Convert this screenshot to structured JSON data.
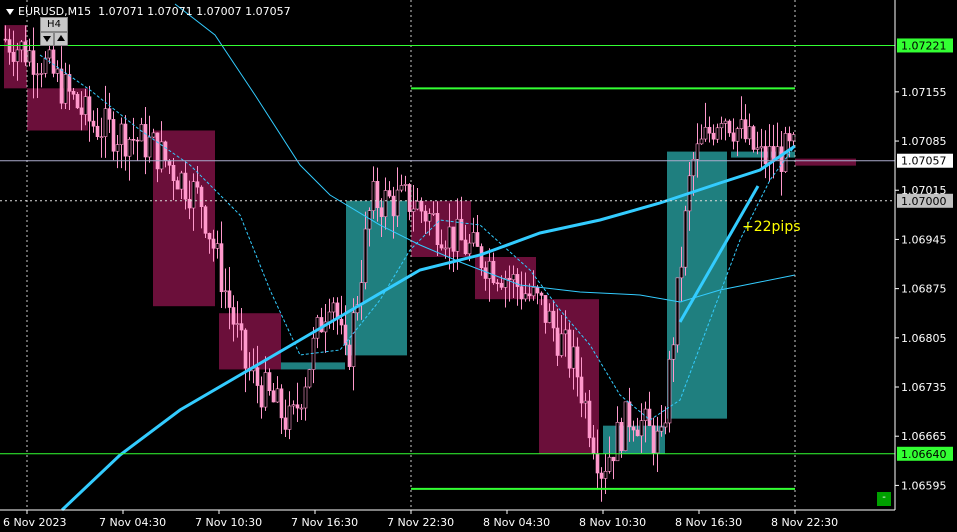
{
  "header": {
    "symbol_timeframe": "EURUSD,M15",
    "ohlc": "1.07071 1.07071 1.07007 1.07057"
  },
  "timeframe_box": {
    "label": "H4"
  },
  "annotation": {
    "text": "+22pips"
  },
  "price_axis": {
    "labels": [
      "1.07155",
      "1.07085",
      "1.07015",
      "1.06945",
      "1.06875",
      "1.06805",
      "1.06735",
      "1.06665",
      "1.06595"
    ],
    "tags": {
      "upper_level": "1.07221",
      "current_price": "1.07057",
      "crosshair_price": "1.07000",
      "lower_level": "1.06640"
    }
  },
  "time_axis": {
    "labels": [
      "6 Nov 2023",
      "7 Nov 04:30",
      "7 Nov 10:30",
      "7 Nov 16:30",
      "7 Nov 22:30",
      "8 Nov 04:30",
      "8 Nov 10:30",
      "8 Nov 16:30",
      "8 Nov 22:30"
    ]
  },
  "colors": {
    "bull_candle": "#ff99cc",
    "bear_candle": "#ff99cc",
    "h4_bear_box": "#6b0f3a",
    "h4_bull_box": "#1f7f7f",
    "ma_fast": "#33ccff",
    "ma_slow": "#33ccff",
    "level_lines": "#33ff33",
    "tag_green": "#33ff33",
    "tag_gray": "#c0c0c0",
    "pips_text": "#ffff00"
  },
  "chart_data": {
    "type": "candlestick",
    "symbol": "EURUSD",
    "timeframe": "M15",
    "y_range": [
      1.0656,
      1.0728
    ],
    "x_labels": [
      "6 Nov 2023",
      "7 Nov 04:30",
      "7 Nov 10:30",
      "7 Nov 16:30",
      "7 Nov 22:30",
      "8 Nov 04:30",
      "8 Nov 10:30",
      "8 Nov 16:30",
      "8 Nov 22:30"
    ],
    "horizontal_levels": [
      1.07221,
      1.07057,
      1.07,
      1.0664
    ],
    "session_range_lines": [
      1.0716,
      1.0659
    ],
    "h4_boxes": [
      {
        "start_label": "6 Nov 2023",
        "open": 1.0725,
        "close": 1.0716,
        "dir": "bear"
      },
      {
        "start_label": "6 Nov 2023",
        "open": 1.0716,
        "close": 1.071,
        "dir": "bear"
      },
      {
        "start_label": "7 Nov 04:30",
        "open": 1.071,
        "close": 1.0685,
        "dir": "bear"
      },
      {
        "start_label": "7 Nov 10:30",
        "open": 1.0684,
        "close": 1.0676,
        "dir": "bear"
      },
      {
        "start_label": "7 Nov 10:30",
        "open": 1.0676,
        "close": 1.0677,
        "dir": "bull"
      },
      {
        "start_label": "7 Nov 16:30",
        "open": 1.0678,
        "close": 1.07,
        "dir": "bull"
      },
      {
        "start_label": "7 Nov 22:30",
        "open": 1.07,
        "close": 1.0692,
        "dir": "bear"
      },
      {
        "start_label": "8 Nov 04:30",
        "open": 1.0692,
        "close": 1.0686,
        "dir": "bear"
      },
      {
        "start_label": "8 Nov 04:30",
        "open": 1.0686,
        "close": 1.0664,
        "dir": "bear"
      },
      {
        "start_label": "8 Nov 10:30",
        "open": 1.0664,
        "close": 1.0668,
        "dir": "bull"
      },
      {
        "start_label": "8 Nov 16:30",
        "open": 1.0669,
        "close": 1.0707,
        "dir": "bull"
      },
      {
        "start_label": "8 Nov 16:30",
        "open": 1.0707,
        "close": 1.0707,
        "dir": "bull"
      },
      {
        "start_label": "8 Nov 22:30",
        "open": 1.0706,
        "close": 1.0705,
        "dir": "bear"
      }
    ]
  }
}
